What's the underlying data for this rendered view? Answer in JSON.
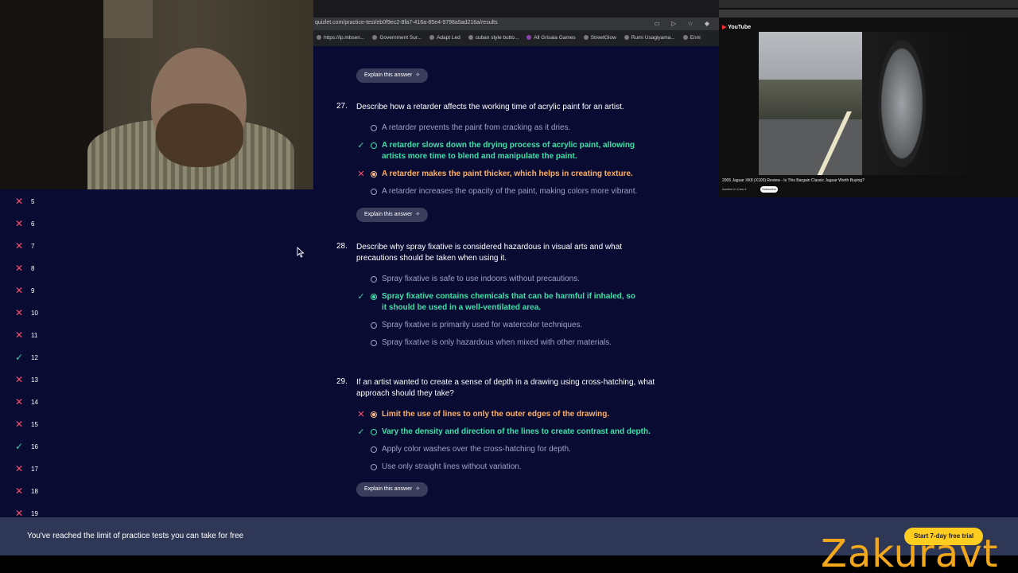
{
  "browser": {
    "url": "quizlet.com/practice-test/eb0f9ec2-8fa7-416a-85e4-9798a5ad216a/results",
    "bookmarks": [
      "https://lp.mbsen...",
      "Government Sur...",
      "Adapt Led",
      "cuban style butto...",
      "All Grisaia Games",
      "StreetGlow",
      "Rumi Usagiyama...",
      "Enni"
    ]
  },
  "youtube": {
    "logo": "YouTube",
    "video_title": "2005 Jaguar XK8 (X100) Review - Is This Bargain Classic Jaguar Worth Buying?",
    "channel": "Auction in Cars 4",
    "subscribe": "Subscribe"
  },
  "sidebar": {
    "items": [
      {
        "num": "5",
        "status": "wrong"
      },
      {
        "num": "6",
        "status": "wrong"
      },
      {
        "num": "7",
        "status": "wrong"
      },
      {
        "num": "8",
        "status": "wrong"
      },
      {
        "num": "9",
        "status": "wrong"
      },
      {
        "num": "10",
        "status": "wrong"
      },
      {
        "num": "11",
        "status": "wrong"
      },
      {
        "num": "12",
        "status": "correct"
      },
      {
        "num": "13",
        "status": "wrong"
      },
      {
        "num": "14",
        "status": "wrong"
      },
      {
        "num": "15",
        "status": "wrong"
      },
      {
        "num": "16",
        "status": "correct"
      },
      {
        "num": "17",
        "status": "wrong"
      },
      {
        "num": "18",
        "status": "wrong"
      },
      {
        "num": "19",
        "status": "wrong"
      }
    ]
  },
  "explain_label": "Explain this answer",
  "questions": [
    {
      "num": "27.",
      "text": "Describe how a retarder affects the working time of acrylic paint for an artist.",
      "options": [
        "A retarder prevents the paint from cracking as it dries.",
        "A retarder slows down the drying process of acrylic paint, allowing artists more time to blend and manipulate the paint.",
        "A retarder makes the paint thicker, which helps in creating texture.",
        "A retarder increases the opacity of the paint, making colors more vibrant."
      ]
    },
    {
      "num": "28.",
      "text": "Describe why spray fixative is considered hazardous in visual arts and what precautions should be taken when using it.",
      "options": [
        "Spray fixative is safe to use indoors without precautions.",
        "Spray fixative contains chemicals that can be harmful if inhaled, so it should be used in a well-ventilated area.",
        "Spray fixative is primarily used for watercolor techniques.",
        "Spray fixative is only hazardous when mixed with other materials."
      ]
    },
    {
      "num": "29.",
      "text": "If an artist wanted to create a sense of depth in a drawing using cross-hatching, what approach should they take?",
      "options": [
        "Limit the use of lines to only the outer edges of the drawing.",
        "Vary the density and direction of the lines to create contrast and depth.",
        "Apply color washes over the cross-hatching for depth.",
        "Use only straight lines without variation."
      ]
    }
  ],
  "banner": {
    "message": "You've reached the limit of practice tests you can take for free",
    "cta": "Start 7-day free trial"
  },
  "watermark": "Zakuravt",
  "colors": {
    "background": "#0a0b33",
    "correct": "#3ee0a8",
    "wrong": "#ffb060",
    "wrong_mark": "#ff4d6d",
    "cta": "#ffcd1f",
    "banner": "#2e3856"
  }
}
